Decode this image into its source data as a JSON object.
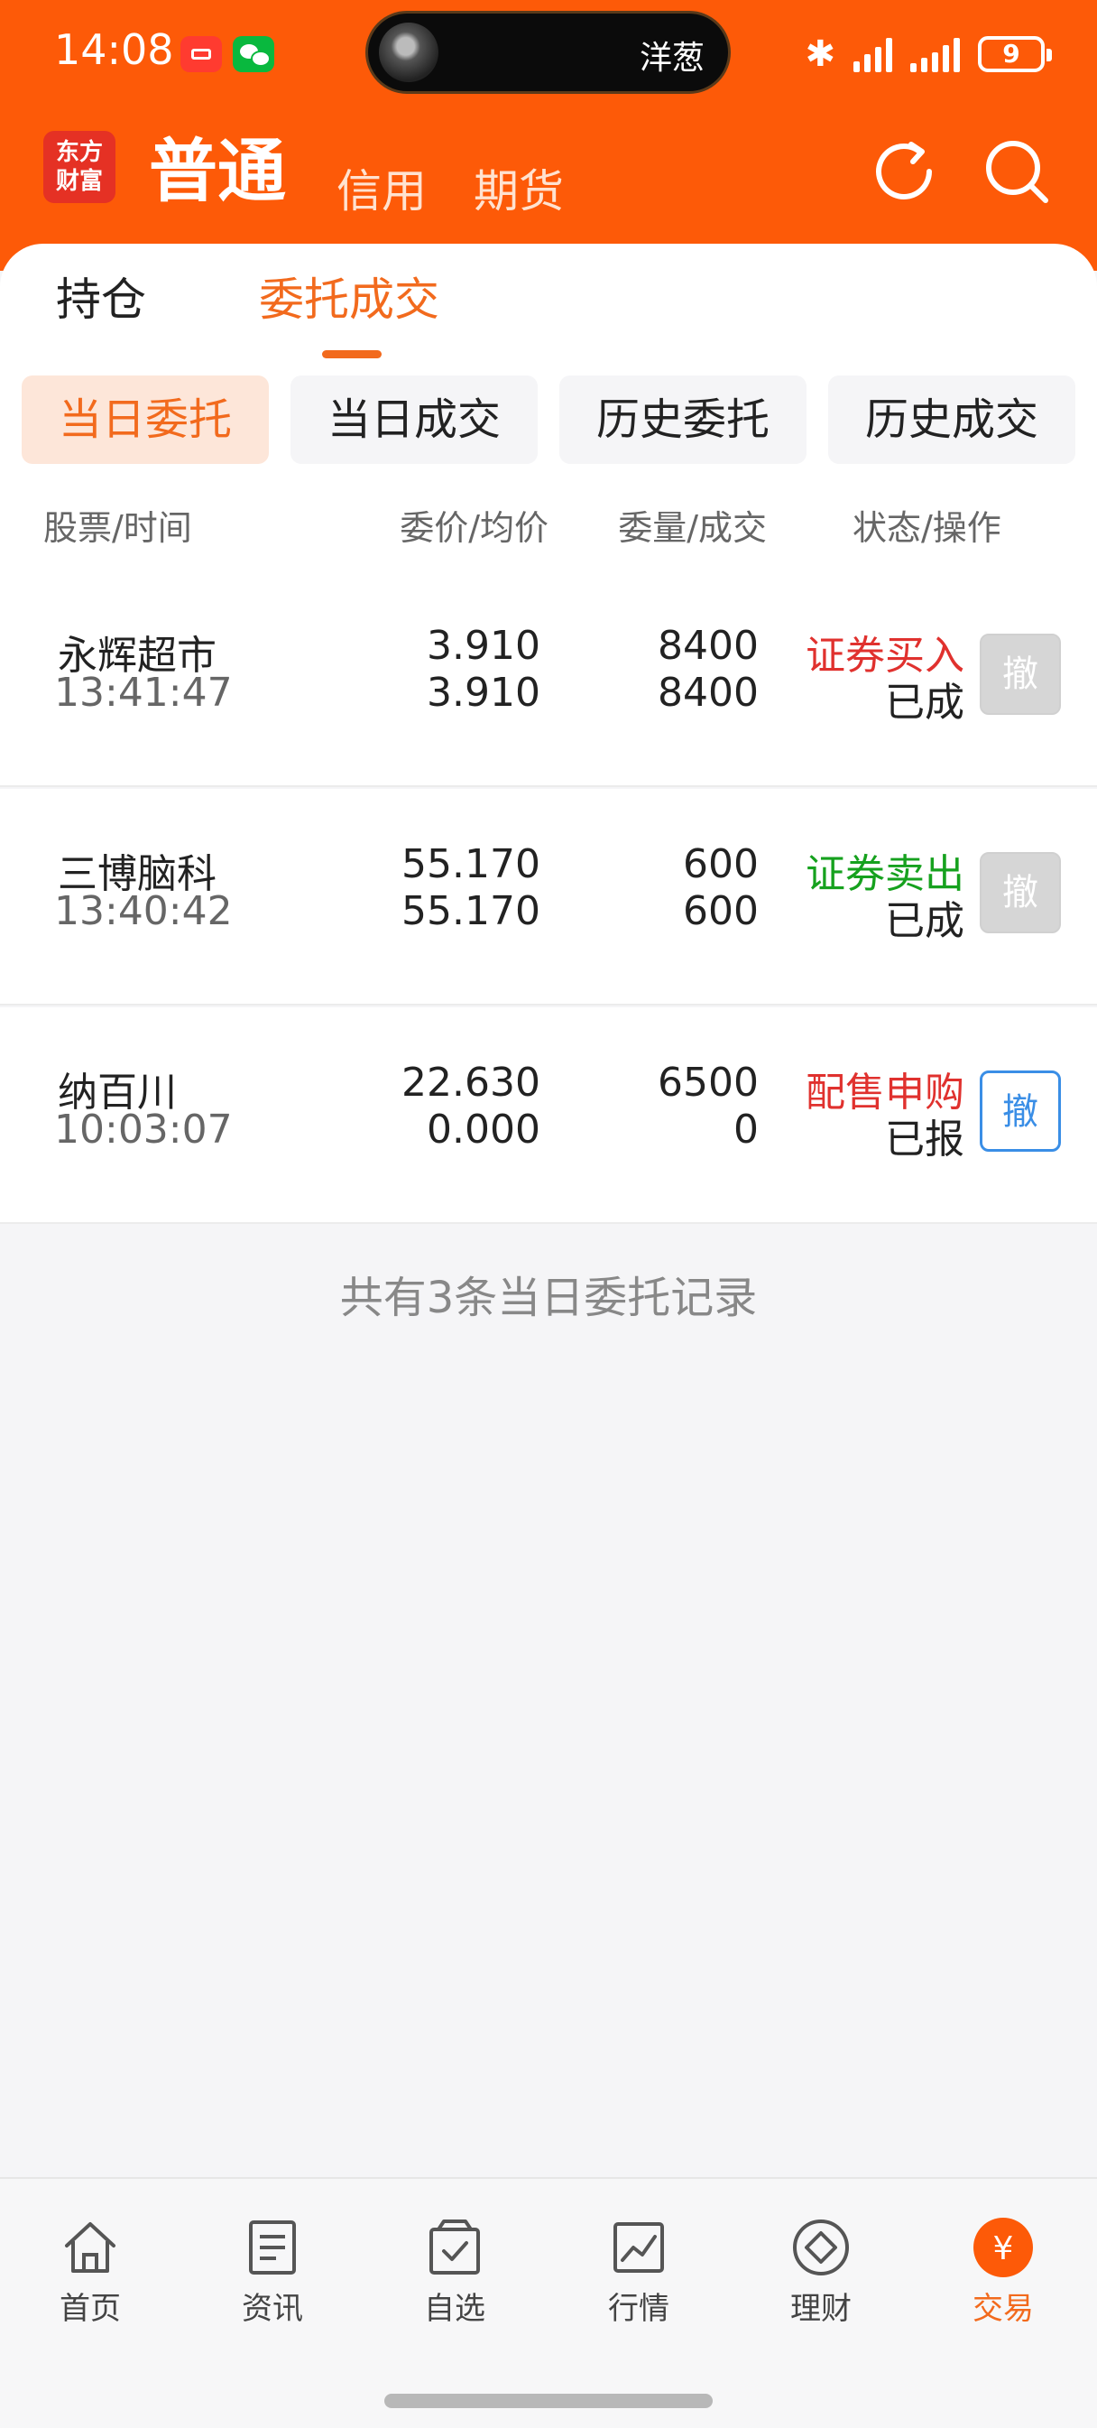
{
  "status_bar": {
    "time": "14:08",
    "island_text": "洋葱",
    "battery": "9"
  },
  "header": {
    "logo_line1": "东方",
    "logo_line2": "财富",
    "account_tabs": [
      "普通",
      "信用",
      "期货"
    ]
  },
  "main_tabs": [
    "持仓",
    "委托成交"
  ],
  "sub_tabs": [
    "当日委托",
    "当日成交",
    "历史委托",
    "历史成交"
  ],
  "table": {
    "headers": [
      "股票/时间",
      "委价/均价",
      "委量/成交",
      "状态/操作"
    ],
    "rows": [
      {
        "name": "永辉超市",
        "time": "13:41:47",
        "price": "3.910",
        "avg_price": "3.910",
        "qty": "8400",
        "filled": "8400",
        "type": "证券买入",
        "status": "已成",
        "cancel_label": "撤"
      },
      {
        "name": "三博脑科",
        "time": "13:40:42",
        "price": "55.170",
        "avg_price": "55.170",
        "qty": "600",
        "filled": "600",
        "type": "证券卖出",
        "status": "已成",
        "cancel_label": "撤"
      },
      {
        "name": "纳百川",
        "time": "10:03:07",
        "price": "22.630",
        "avg_price": "0.000",
        "qty": "6500",
        "filled": "0",
        "type": "配售申购",
        "status": "已报",
        "cancel_label": "撤"
      }
    ]
  },
  "summary": "共有3条当日委托记录",
  "bottom_nav": [
    {
      "label": "首页",
      "icon": "home-icon"
    },
    {
      "label": "资讯",
      "icon": "news-icon"
    },
    {
      "label": "自选",
      "icon": "watchlist-icon"
    },
    {
      "label": "行情",
      "icon": "chart-icon"
    },
    {
      "label": "理财",
      "icon": "finance-icon"
    },
    {
      "label": "交易",
      "icon": "trade-icon",
      "glyph": "¥"
    }
  ],
  "colors": {
    "brand_orange": "#fd5a08",
    "accent": "#f26a1d",
    "buy_red": "#e0312e",
    "sell_green": "#16a11e",
    "cancel_blue": "#3a8ee6"
  }
}
